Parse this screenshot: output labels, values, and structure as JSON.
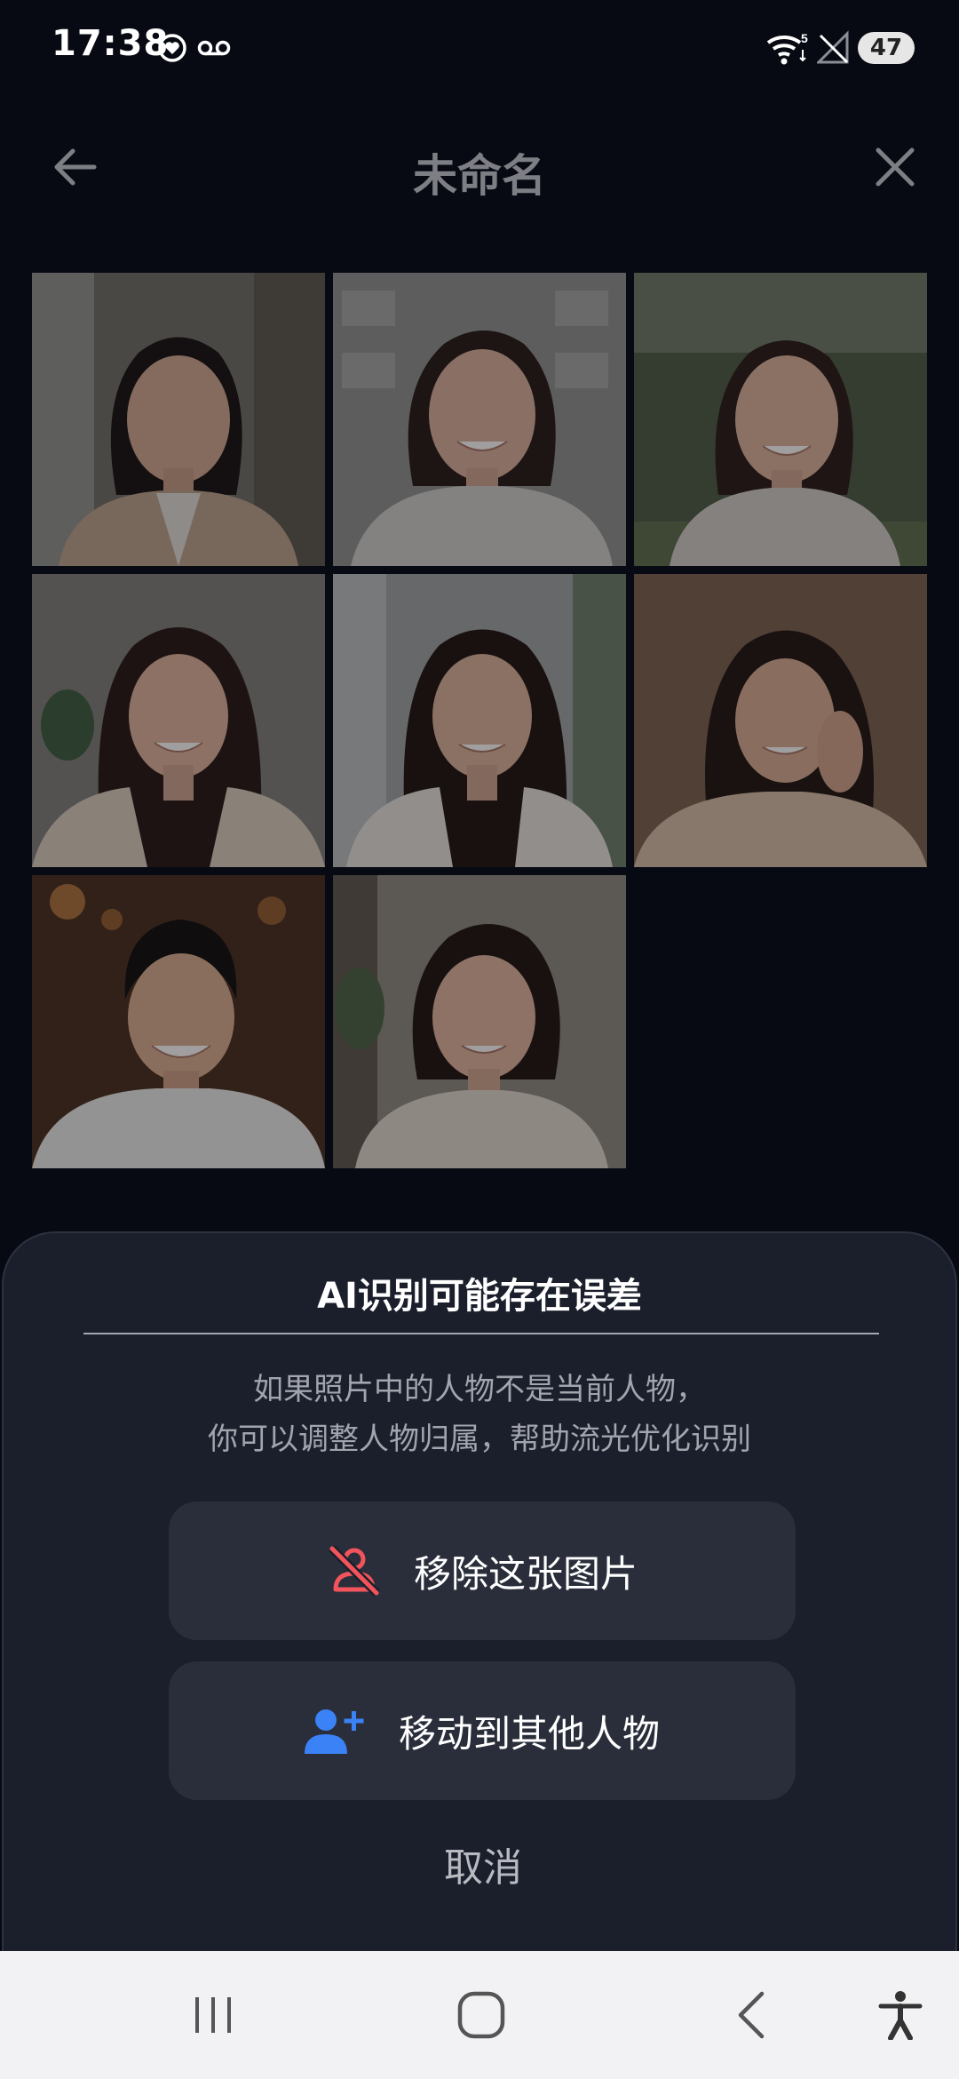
{
  "status_bar": {
    "time": "17:38",
    "battery": "47",
    "icons": [
      "heart-circle-icon",
      "voicemail-icon",
      "wifi-icon",
      "signal-off-icon",
      "battery-icon"
    ]
  },
  "header": {
    "title": "未命名",
    "back_icon": "arrow-left-icon",
    "close_icon": "close-icon"
  },
  "photos": [
    {
      "id": "photo-1"
    },
    {
      "id": "photo-2"
    },
    {
      "id": "photo-3"
    },
    {
      "id": "photo-4"
    },
    {
      "id": "photo-5"
    },
    {
      "id": "photo-6"
    },
    {
      "id": "photo-7"
    },
    {
      "id": "photo-8"
    }
  ],
  "sheet": {
    "title": "AI识别可能存在误差",
    "description_line1": "如果照片中的人物不是当前人物，",
    "description_line2": "你可以调整人物归属，帮助流光优化识别",
    "remove_label": "移除这张图片",
    "move_label": "移动到其他人物",
    "cancel_label": "取消"
  },
  "colors": {
    "background": "#070a13",
    "sheet": "#1b1f2c",
    "button": "#2a2e3b",
    "remove_icon": "#f2545b",
    "move_icon": "#3b82f6",
    "nav_bar": "#f2f2f5"
  },
  "nav": {
    "icons": [
      "recent-apps-icon",
      "home-icon",
      "back-icon",
      "accessibility-icon"
    ]
  }
}
